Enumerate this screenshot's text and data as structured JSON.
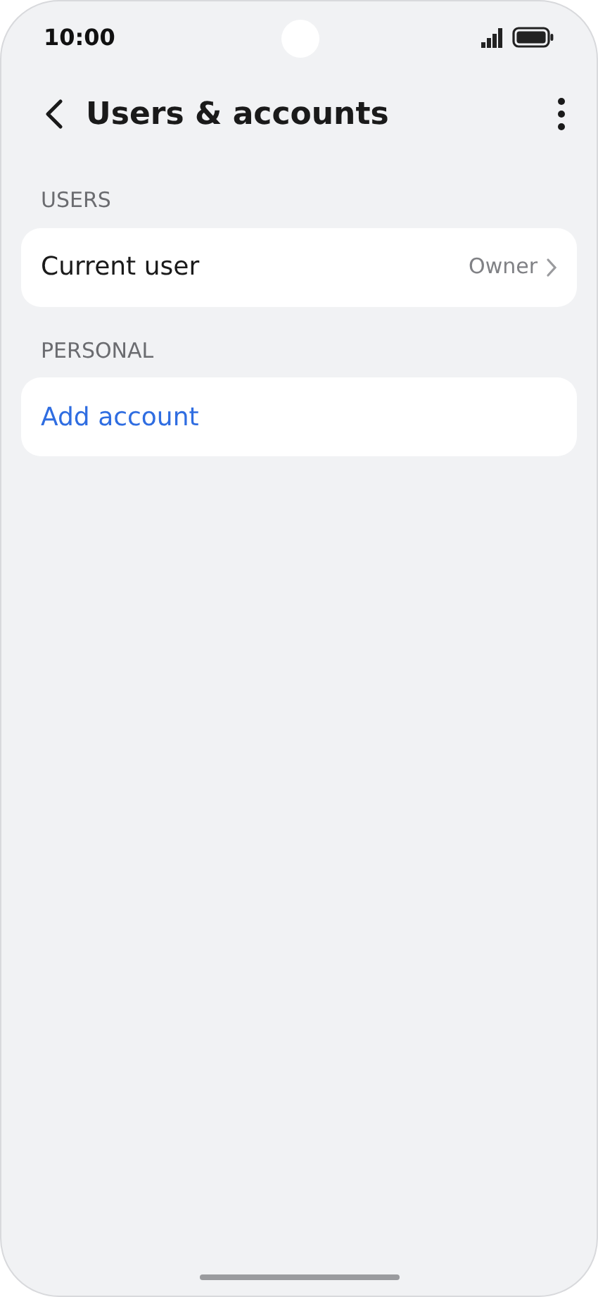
{
  "status_bar": {
    "time": "10:00"
  },
  "header": {
    "title": "Users & accounts"
  },
  "sections": [
    {
      "heading": "USERS",
      "items": [
        {
          "kind": "value",
          "label": "Current user",
          "value": "Owner"
        }
      ]
    },
    {
      "heading": "PERSONAL",
      "items": [
        {
          "kind": "action",
          "label": "Add account"
        }
      ]
    }
  ]
}
